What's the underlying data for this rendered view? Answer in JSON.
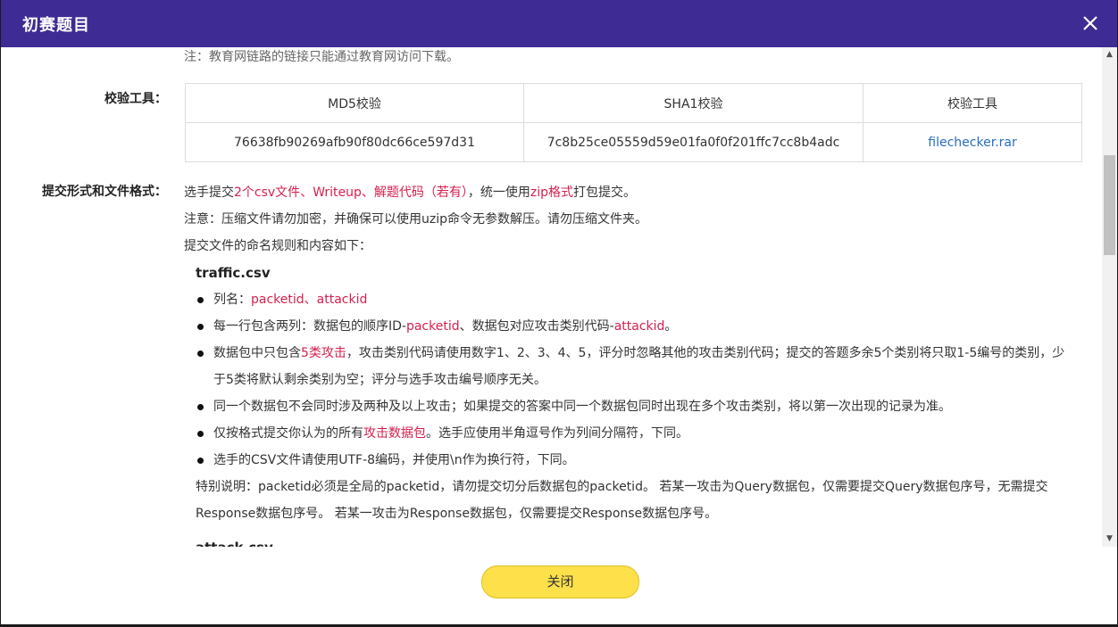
{
  "header": {
    "title": "初赛题目"
  },
  "note_top": "注：教育网链路的链接只能通过教育网访问下载。",
  "verify": {
    "label": "校验工具：",
    "headers": [
      "MD5校验",
      "SHA1校验",
      "校验工具"
    ],
    "row": [
      "76638fb90269afb90f80dc66ce597d31",
      "7c8b25ce05559d59e01fa0f0f201ffc7cc8b4adc",
      "filechecker.rar"
    ]
  },
  "submit": {
    "label": "提交形式和文件格式：",
    "line1": {
      "a": "选手提交",
      "b": "2个csv文件",
      "c": "、",
      "d": "Writeup",
      "e": "、",
      "f": "解题代码（若有）",
      "g": "，统一使用",
      "h": "zip格式",
      "i": "打包提交。"
    },
    "line2": "注意：压缩文件请勿加密，并确保可以使用uzip命令无参数解压。请勿压缩文件夹。",
    "line3": "提交文件的命名规则和内容如下：",
    "file1": "traffic.csv",
    "b1": {
      "a": "列名：",
      "b": "packetid",
      "c": "、",
      "d": "attackid"
    },
    "b2": {
      "a": "每一行包含两列：数据包的顺序ID-",
      "b": "packetid",
      "c": "、数据包对应攻击类别代码-",
      "d": "attackid",
      "e": "。"
    },
    "b3": {
      "a": "数据包中只包含",
      "b": "5类攻击",
      "c": "，攻击类别代码请使用数字1、2、3、4、5，评分时忽略其他的攻击类别代码；提交的答题多余5个类别将只取1-5编号的类别，少于5类将默认剩余类别为空；评分与选手攻击编号顺序无关。"
    },
    "b4": "同一个数据包不会同时涉及两种及以上攻击；如果提交的答案中同一个数据包同时出现在多个攻击类别，将以第一次出现的记录为准。",
    "b5": {
      "a": "仅按格式提交你认为的所有",
      "b": "攻击数据包",
      "c": "。选手应使用半角逗号作为列间分隔符，下同。"
    },
    "b6": "选手的CSV文件请使用UTF-8编码，并使用\\n作为换行符，下同。",
    "special": "特别说明：packetid必须是全局的packetid，请勿提交切分后数据包的packetid。 若某一攻击为Query数据包，仅需要提交Query数据包序号，无需提交Response数据包序号。 若某一攻击为Response数据包，仅需要提交Response数据包序号。",
    "file2": "attack.csv"
  },
  "footer": {
    "close_label": "关闭"
  }
}
